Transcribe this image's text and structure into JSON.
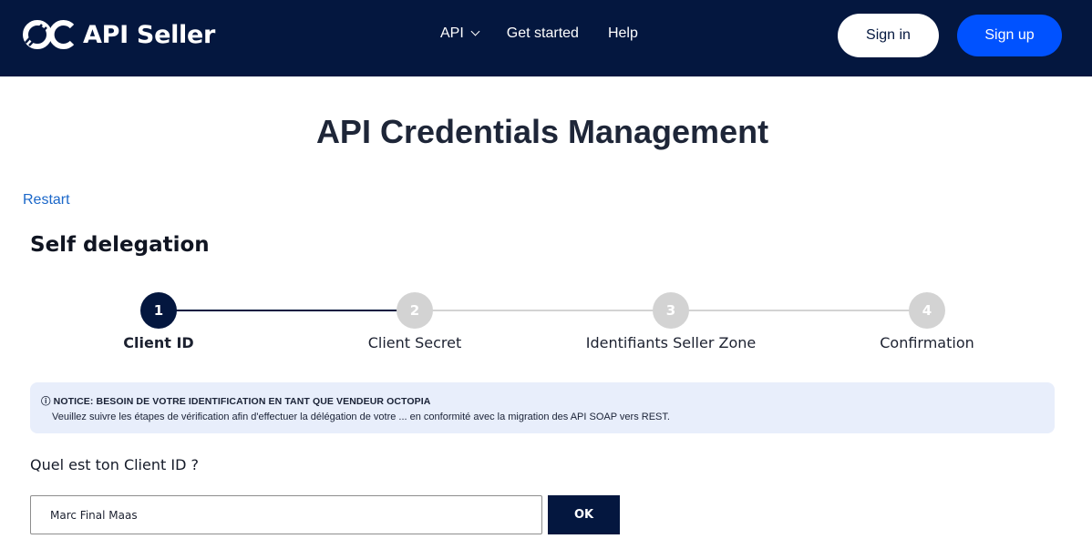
{
  "header": {
    "brand": "API Seller",
    "nav": [
      {
        "label": "API",
        "has_dropdown": true
      },
      {
        "label": "Get started"
      },
      {
        "label": "Help"
      }
    ],
    "sign_in": "Sign in",
    "sign_up": "Sign up"
  },
  "colors": {
    "header_bg": "#04173f",
    "primary_blue": "#0052ff",
    "link": "#1b67c9",
    "step_active": "#04173f",
    "step_inactive": "#d3d3d3",
    "notice_bg": "#e8eefb"
  },
  "page": {
    "title": "API Credentials Management",
    "restart": "Restart",
    "section_title": "Self delegation"
  },
  "stepper": {
    "current": 1,
    "steps": [
      {
        "number": "1",
        "label": "Client ID"
      },
      {
        "number": "2",
        "label": "Client Secret"
      },
      {
        "number": "3",
        "label": "Identifiants Seller Zone"
      },
      {
        "number": "4",
        "label": "Confirmation"
      }
    ]
  },
  "notice": {
    "icon": "info-icon",
    "title": "NOTICE: BESOIN DE VOTRE IDENTIFICATION EN TANT QUE VENDEUR OCTOPIA",
    "text": "Veuillez suivre les étapes de vérification afin d'effectuer la délégation de votre ... en conformité avec la migration des API SOAP vers REST."
  },
  "form": {
    "question": "Quel est ton Client ID ?",
    "input_value": "Marc Final Maas",
    "submit": "OK"
  }
}
